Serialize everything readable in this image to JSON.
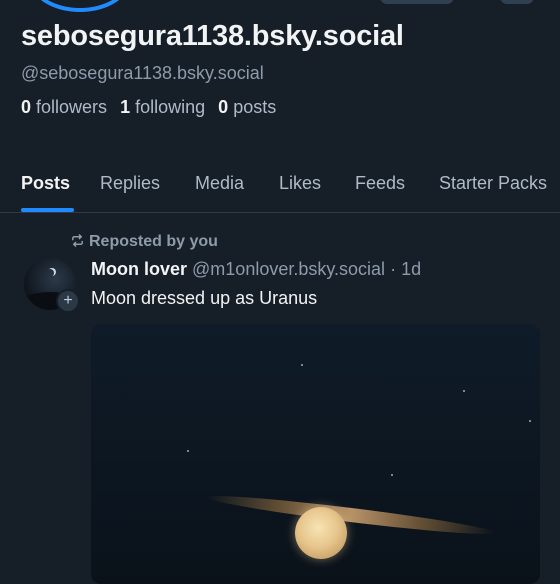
{
  "profile": {
    "display_name": "sebosegura1138.bsky.social",
    "handle": "@sebosegura1138.bsky.social",
    "followers_count": "0",
    "followers_label": "followers",
    "following_count": "1",
    "following_label": "following",
    "posts_count": "0",
    "posts_label": "posts"
  },
  "tabs": [
    {
      "label": "Posts",
      "active": true
    },
    {
      "label": "Replies"
    },
    {
      "label": "Media"
    },
    {
      "label": "Likes"
    },
    {
      "label": "Feeds"
    },
    {
      "label": "Starter Packs"
    }
  ],
  "post": {
    "repost_label": "Reposted by you",
    "author_name": "Moon lover",
    "author_handle": "@m1onlover.bsky.social",
    "separator": "·",
    "time": "1d",
    "text": "Moon dressed up as Uranus"
  },
  "colors": {
    "accent": "#208bfe",
    "background": "#161e27"
  }
}
